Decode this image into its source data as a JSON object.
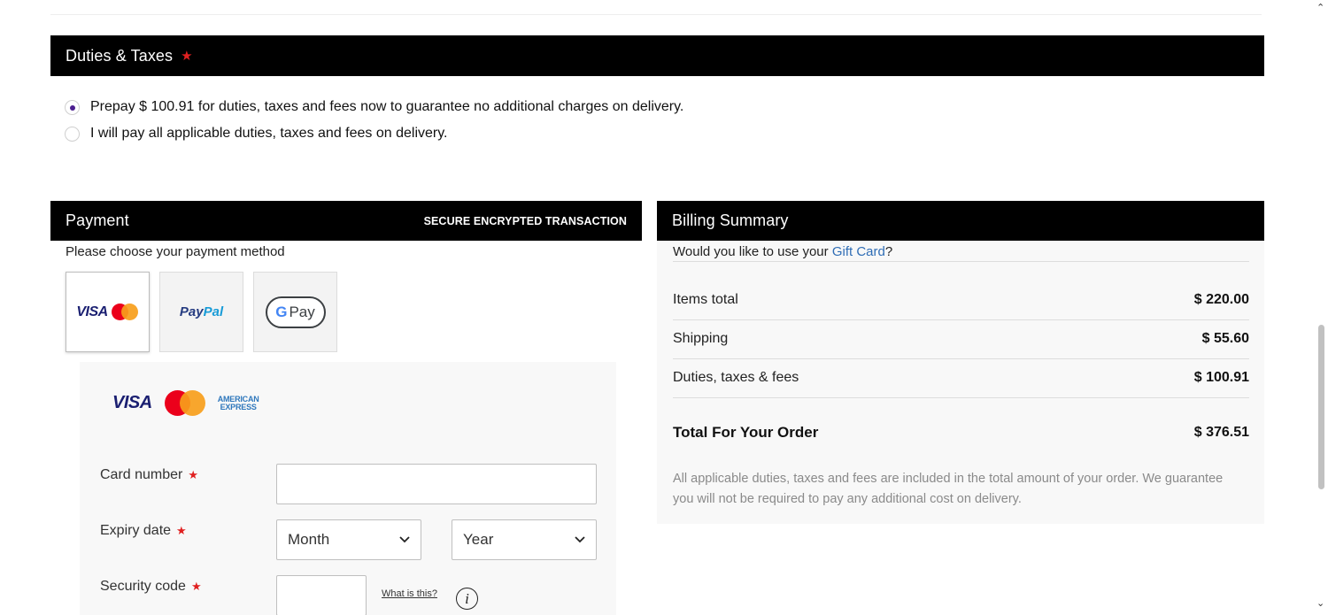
{
  "duties": {
    "title": "Duties & Taxes",
    "required_mark": "★",
    "options": [
      {
        "label": "Prepay $ 100.91 for duties, taxes and fees now to guarantee no additional charges on delivery.",
        "selected": true
      },
      {
        "label": "I will pay all applicable duties, taxes and fees on delivery.",
        "selected": false
      }
    ]
  },
  "payment": {
    "title": "Payment",
    "secure_label": "SECURE ENCRYPTED TRANSACTION",
    "choose_text": "Please choose your payment method",
    "methods": [
      {
        "name": "card",
        "visa": "VISA",
        "selected": true
      },
      {
        "name": "paypal",
        "label_part1": "Pay",
        "label_part2": "Pal"
      },
      {
        "name": "google-pay",
        "g": "G",
        "pay": "Pay"
      }
    ],
    "card_brands": {
      "visa": "VISA",
      "amex_line1": "AMERICAN",
      "amex_line2": "EXPRESS"
    },
    "fields": {
      "card_number_label": "Card number",
      "expiry_label": "Expiry date",
      "month_value": "Month",
      "year_value": "Year",
      "security_label": "Security code",
      "what_is_this": "What is this?",
      "info_glyph": "i"
    },
    "required_mark": "★",
    "chevron": "⌄"
  },
  "billing": {
    "title": "Billing Summary",
    "gift_prefix": "Would you like to use your ",
    "gift_link": "Gift Card",
    "gift_suffix": "?",
    "rows": [
      {
        "label": "Items total",
        "value": "$ 220.00"
      },
      {
        "label": "Shipping",
        "value": "$ 55.60"
      },
      {
        "label": "Duties, taxes & fees",
        "value": "$ 100.91"
      }
    ],
    "total": {
      "label": "Total For Your Order",
      "value": "$ 376.51"
    },
    "note": "All applicable duties, taxes and fees are included in the total amount of your order. We guarantee you will not be required to pay any additional cost on delivery."
  },
  "colors": {
    "header_bg": "#000000",
    "required_star": "#e02020",
    "radio_selected": "#4b1e8f",
    "link": "#2f6db5",
    "panel_bg": "#f8f8f8"
  },
  "scrollbar": {
    "up_glyph": "⌃",
    "down_glyph": "⌄"
  }
}
